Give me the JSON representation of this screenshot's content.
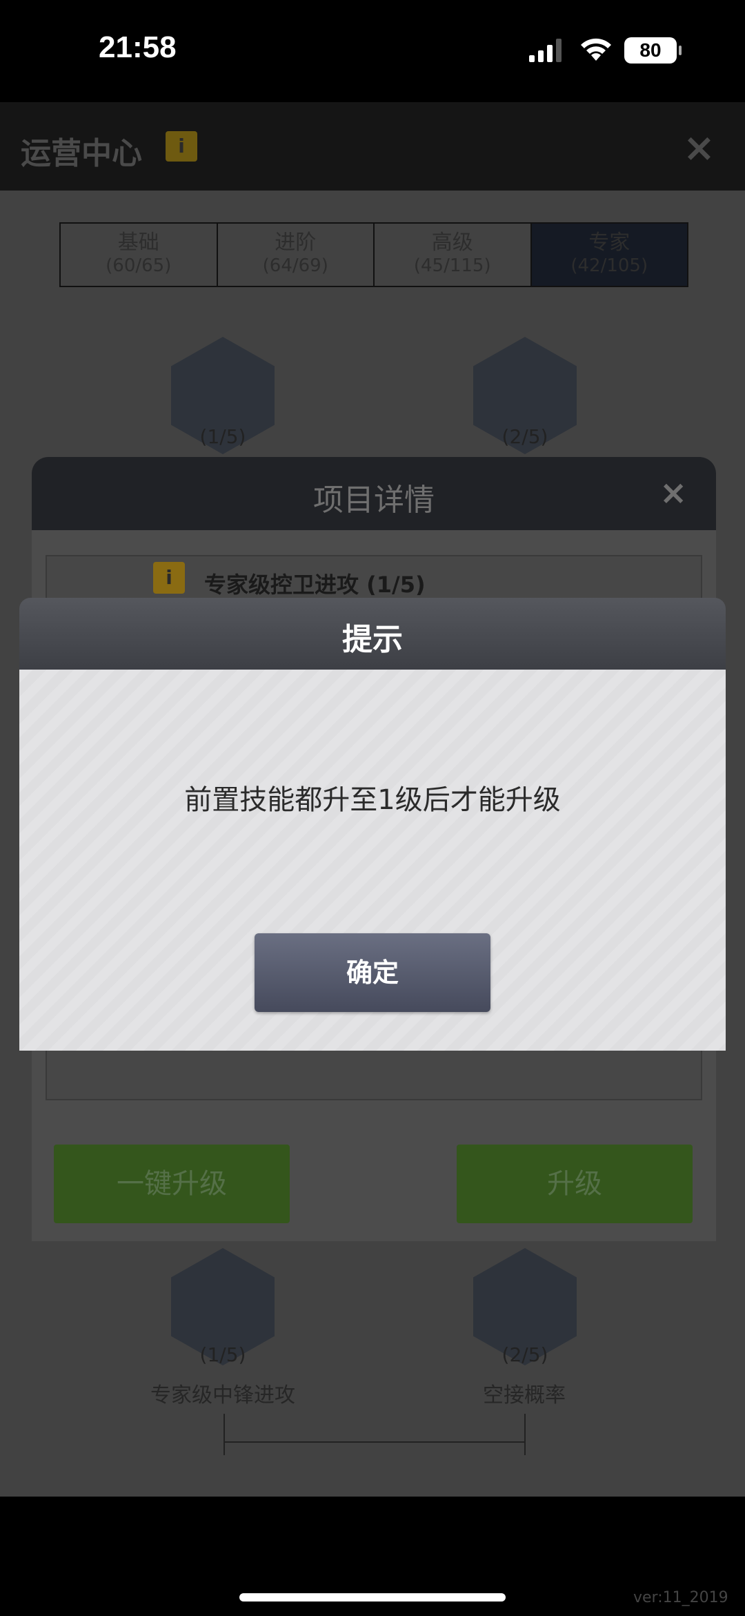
{
  "status_bar": {
    "time": "21:58",
    "battery": "80"
  },
  "game": {
    "title": "运营中心",
    "info_badge": "i",
    "close_icon": "×",
    "tabs": [
      {
        "label": "基础",
        "count": "(60/65)"
      },
      {
        "label": "进阶",
        "count": "(64/69)"
      },
      {
        "label": "高级",
        "count": "(45/115)"
      },
      {
        "label": "专家",
        "count": "(42/105)"
      }
    ],
    "skills_top": [
      {
        "count": "(1/5)"
      },
      {
        "count": "(2/5)"
      }
    ],
    "skills_bottom": [
      {
        "count": "(1/5)",
        "label": "专家级中锋进攻"
      },
      {
        "count": "(2/5)",
        "label": "空接概率"
      }
    ],
    "version": "ver:11_2019"
  },
  "detail_panel": {
    "title": "项目详情",
    "close_icon": "×",
    "info_badge": "i",
    "skill_name": "专家级控卫进攻 (1/5)",
    "one_click_upgrade": "一键升级",
    "upgrade": "升级"
  },
  "modal": {
    "title": "提示",
    "message": "前置技能都升至1级后才能升级",
    "confirm": "确定"
  },
  "colors": {
    "modal_header": "#4a4c52",
    "confirm_button": "#555a6e",
    "green_button": "#34561c"
  }
}
